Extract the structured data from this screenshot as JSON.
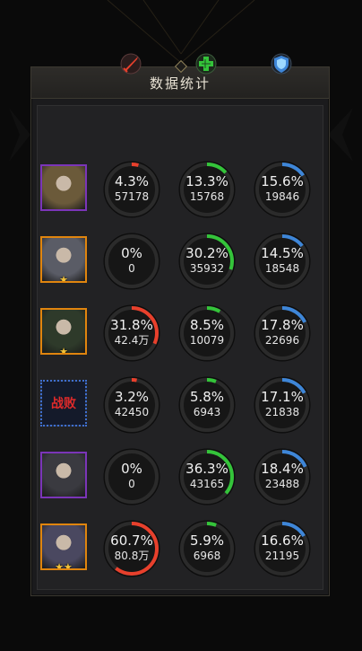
{
  "title": "数据统计",
  "colors": {
    "damage": "#e8402c",
    "heal": "#34c43a",
    "shield": "#3e86d8",
    "track": "#141414"
  },
  "columns": [
    {
      "icon": "sword-damage-icon",
      "color": "#e8402c"
    },
    {
      "icon": "heal-cross-icon",
      "color": "#34c43a"
    },
    {
      "icon": "shield-icon",
      "color": "#3e86d8"
    }
  ],
  "heroes": [
    {
      "frame": "purple",
      "stars": "",
      "defeated": "",
      "stats": [
        {
          "pct": "4.3%",
          "val": "57178",
          "fraction": 0.043
        },
        {
          "pct": "13.3%",
          "val": "15768",
          "fraction": 0.133
        },
        {
          "pct": "15.6%",
          "val": "19846",
          "fraction": 0.156
        }
      ]
    },
    {
      "frame": "orange",
      "stars": "★",
      "defeated": "",
      "stats": [
        {
          "pct": "0%",
          "val": "0",
          "fraction": 0
        },
        {
          "pct": "30.2%",
          "val": "35932",
          "fraction": 0.302
        },
        {
          "pct": "14.5%",
          "val": "18548",
          "fraction": 0.145
        }
      ]
    },
    {
      "frame": "orange",
      "stars": "★",
      "defeated": "",
      "stats": [
        {
          "pct": "31.8%",
          "val": "42.4万",
          "fraction": 0.318
        },
        {
          "pct": "8.5%",
          "val": "10079",
          "fraction": 0.085
        },
        {
          "pct": "17.8%",
          "val": "22696",
          "fraction": 0.178
        }
      ]
    },
    {
      "frame": "blue",
      "stars": "",
      "defeated": "战败",
      "stats": [
        {
          "pct": "3.2%",
          "val": "42450",
          "fraction": 0.032
        },
        {
          "pct": "5.8%",
          "val": "6943",
          "fraction": 0.058
        },
        {
          "pct": "17.1%",
          "val": "21838",
          "fraction": 0.171
        }
      ]
    },
    {
      "frame": "purple",
      "stars": "",
      "defeated": "",
      "stats": [
        {
          "pct": "0%",
          "val": "0",
          "fraction": 0
        },
        {
          "pct": "36.3%",
          "val": "43165",
          "fraction": 0.363
        },
        {
          "pct": "18.4%",
          "val": "23488",
          "fraction": 0.184
        }
      ]
    },
    {
      "frame": "orange",
      "stars": "★★",
      "defeated": "",
      "stats": [
        {
          "pct": "60.7%",
          "val": "80.8万",
          "fraction": 0.607
        },
        {
          "pct": "5.9%",
          "val": "6968",
          "fraction": 0.059
        },
        {
          "pct": "16.6%",
          "val": "21195",
          "fraction": 0.166
        }
      ]
    }
  ]
}
